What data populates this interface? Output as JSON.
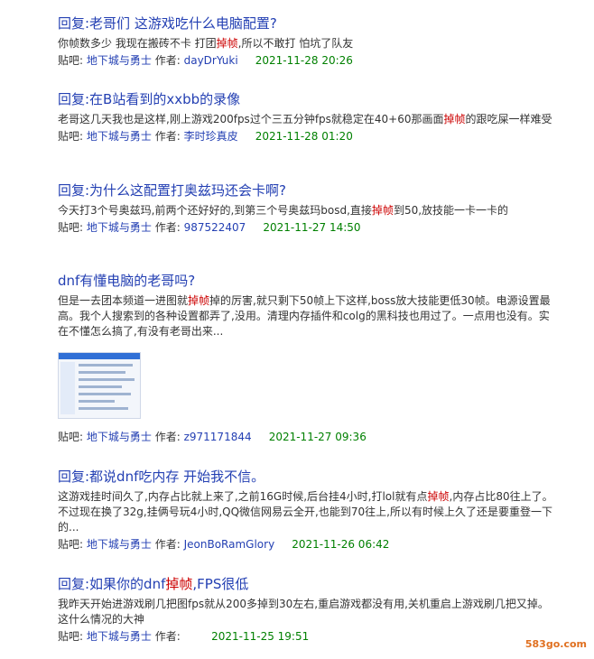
{
  "results": [
    {
      "title_prefix": "回复:老哥们 这游戏吃什么电脑配置?",
      "snippet_parts": [
        "你帧数多少 我现在搬砖不卡 打团",
        "掉帧",
        ",所以不敢打 怕坑了队友"
      ],
      "forum_label": "贴吧:",
      "forum": "地下城与勇士",
      "author_label": "作者:",
      "author": "dayDrYuki",
      "date": "2021-11-28 20:26"
    },
    {
      "title_prefix": "回复:在B站看到的xxbb的录像",
      "snippet_parts": [
        "老哥这几天我也是这样,刚上游戏200fps过个三五分钟fps就稳定在40+60那画面",
        "掉帧",
        "的跟吃屎一样难受"
      ],
      "forum_label": "贴吧:",
      "forum": "地下城与勇士",
      "author_label": "作者:",
      "author": "李时珍真皮",
      "date": "2021-11-28 01:20"
    },
    {
      "title_prefix": "回复:为什么这配置打奥兹玛还会卡啊?",
      "snippet_parts": [
        "今天打3个号奥兹玛,前两个还好好的,到第三个号奥兹玛bosd,直接",
        "掉帧",
        "到50,放技能一卡一卡的"
      ],
      "forum_label": "贴吧:",
      "forum": "地下城与勇士",
      "author_label": "作者:",
      "author": "987522407",
      "date": "2021-11-27 14:50"
    },
    {
      "title_prefix": "dnf有懂电脑的老哥吗?",
      "snippet_parts": [
        "但是一去团本频道一进图就",
        "掉帧",
        "掉的厉害,就只剩下50帧上下这样,boss放大技能更低30帧。电源设置最高。我个人搜索到的各种设置都弄了,没用。清理内存插件和colg的黑科技也用过了。一点用也没有。实在不懂怎么搞了,有没有老哥出来..."
      ],
      "forum_label": "贴吧:",
      "forum": "地下城与勇士",
      "author_label": "作者:",
      "author": "z971171844",
      "date": "2021-11-27 09:36"
    },
    {
      "title_prefix": "回复:都说dnf吃内存 开始我不信。",
      "snippet_parts": [
        "这游戏挂时间久了,内存占比就上来了,之前16G时候,后台挂4小时,打lol就有点",
        "掉帧",
        ",内存占比80往上了。不过现在换了32g,挂俩号玩4小时,QQ微信网易云全开,也能到70往上,所以有时候上久了还是要重登一下的..."
      ],
      "forum_label": "贴吧:",
      "forum": "地下城与勇士",
      "author_label": "作者:",
      "author": "JeonBoRamGlory",
      "date": "2021-11-26 06:42"
    },
    {
      "title_prefix": "回复:如果你的dnf",
      "title_hl": "掉帧",
      "title_suffix": ",FPS很低",
      "snippet_parts": [
        "我昨天开始进游戏刷几把图fps就从200多掉到30左右,重启游戏都没有用,关机重启上游戏刷几把又掉。这什么情况的大神",
        "",
        ""
      ],
      "forum_label": "贴吧:",
      "forum": "地下城与勇士",
      "author_label": "作者:",
      "author": "",
      "date": "2021-11-25 19:51"
    }
  ],
  "watermark": "583go.com",
  "colors": {
    "link": "#2440b3",
    "highlight": "#cc0000",
    "date": "#008000",
    "text": "#333333"
  }
}
